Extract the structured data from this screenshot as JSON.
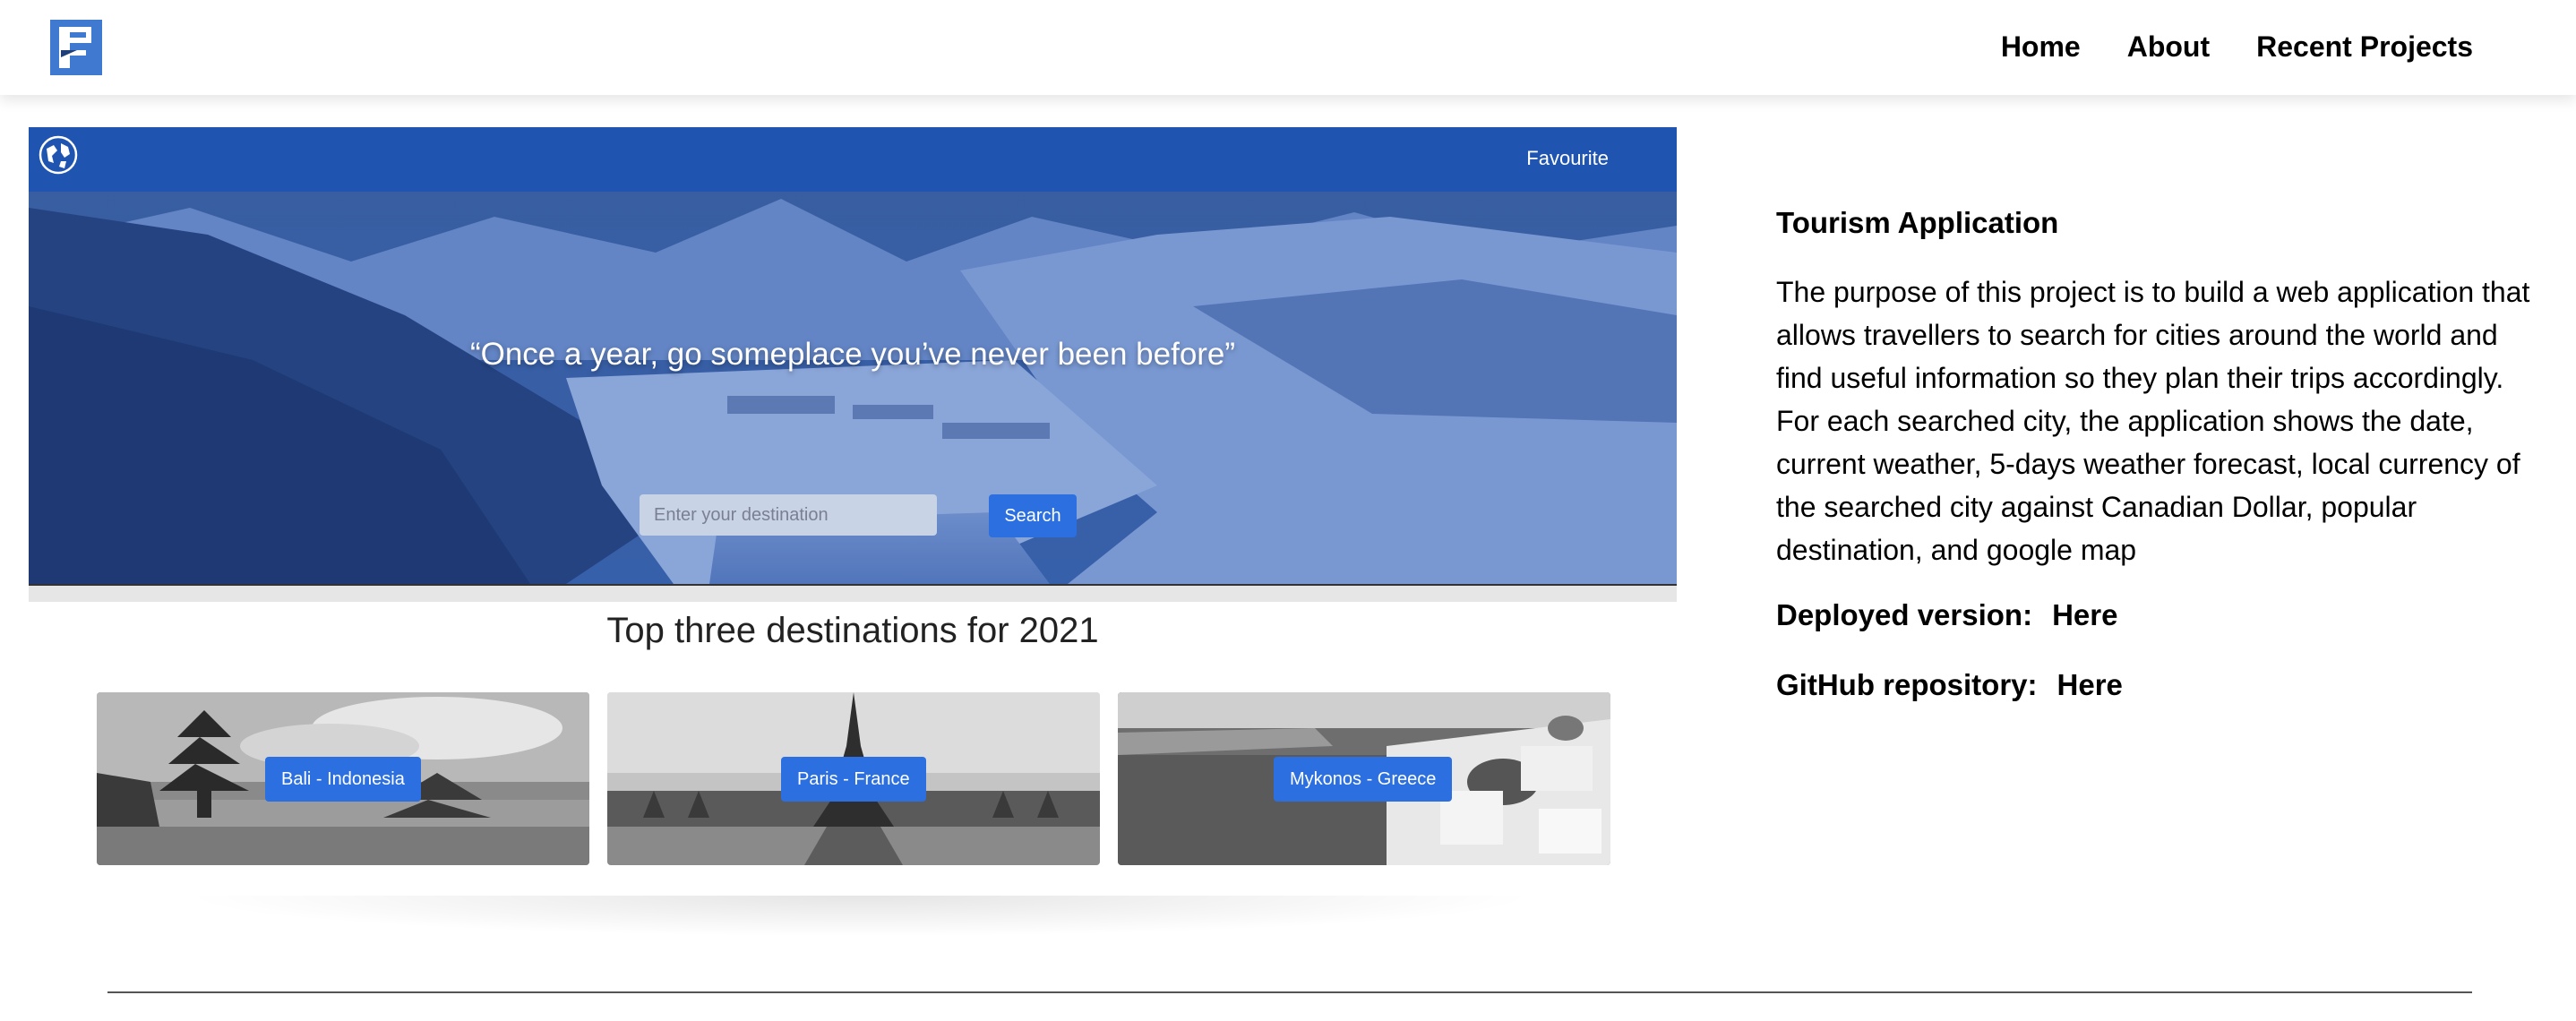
{
  "nav": {
    "logo_icon": "portfolio-logo-icon",
    "links": [
      "Home",
      "About",
      "Recent Projects"
    ]
  },
  "project_screenshot": {
    "favourite_label": "Favourite",
    "quote": "“Once a year, go someplace you’ve never been before”",
    "search_placeholder": "Enter your destination",
    "search_button": "Search",
    "section_title": "Top three destinations for 2021",
    "destinations": [
      {
        "label": "Bali - Indonesia"
      },
      {
        "label": "Paris - France"
      },
      {
        "label": "Mykonos - Greece"
      }
    ],
    "colors": {
      "nav": "#1f55b0",
      "button": "#2b6fe0"
    }
  },
  "info": {
    "title": "Tourism Application",
    "description": "The purpose of this project is to build a web application that allows travellers to search for cities around the world and find useful information so they plan their trips accordingly. For each searched city, the application shows the date, current weather, 5-days weather forecast, local currency of the searched city against Canadian Dollar, popular destination, and google map",
    "deployed_label": "Deployed version:",
    "deployed_link": "Here",
    "github_label": "GitHub repository:",
    "github_link": "Here"
  }
}
